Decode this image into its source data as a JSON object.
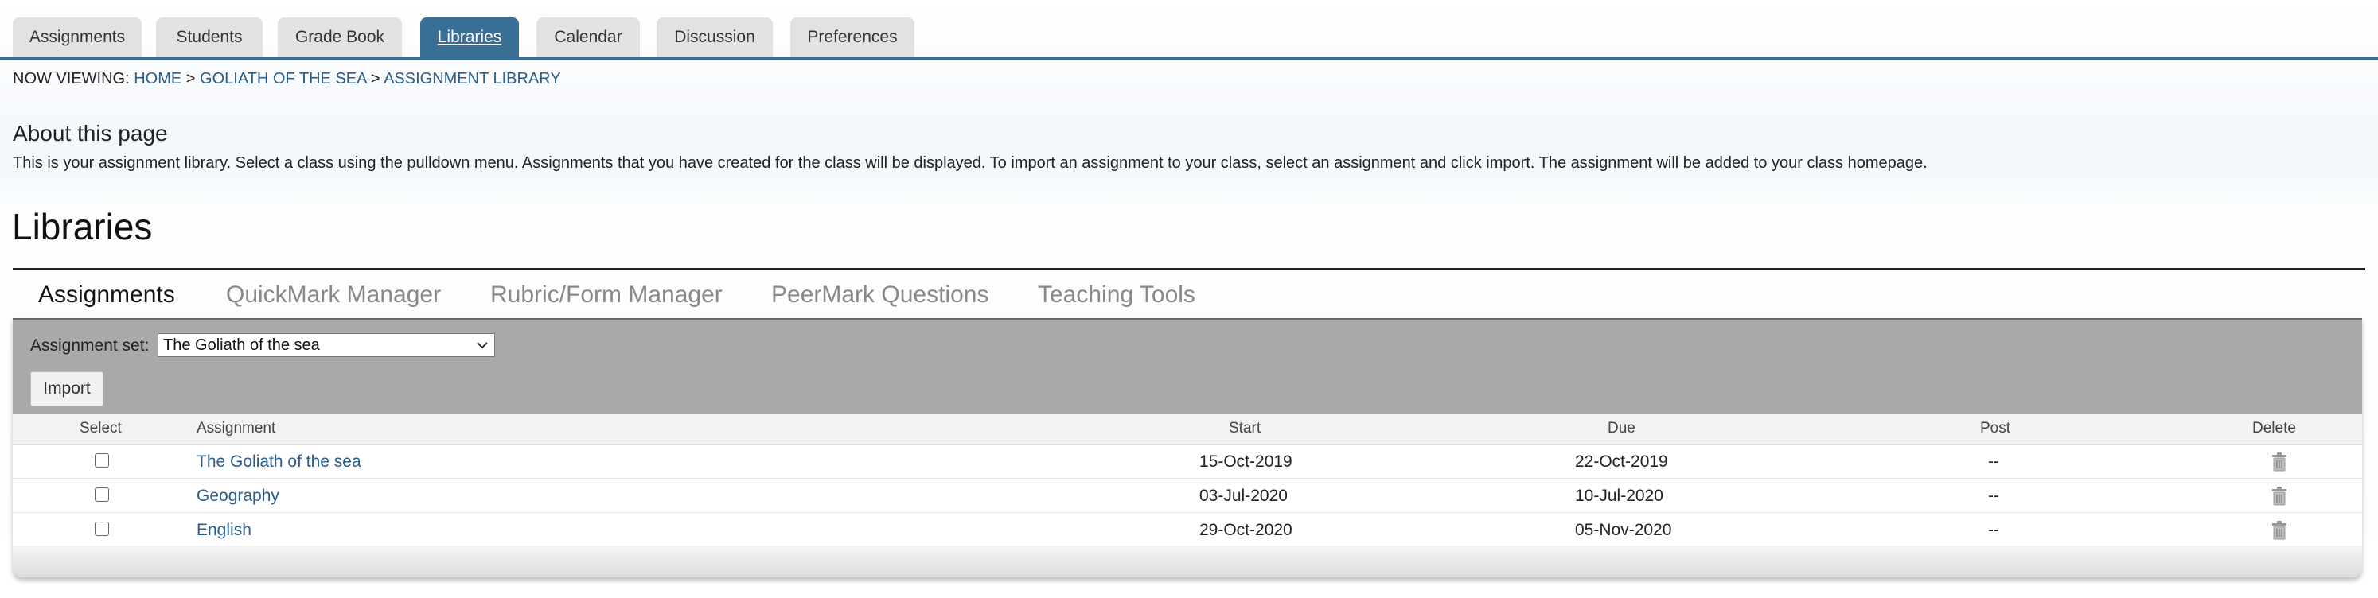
{
  "nav": {
    "tabs": [
      {
        "label": "Assignments"
      },
      {
        "label": "Students"
      },
      {
        "label": "Grade Book"
      },
      {
        "label": "Libraries"
      },
      {
        "label": "Calendar"
      },
      {
        "label": "Discussion"
      },
      {
        "label": "Preferences"
      }
    ],
    "active": "Libraries"
  },
  "breadcrumb": {
    "prefix": "NOW VIEWING:",
    "items": [
      "HOME",
      "GOLIATH OF THE SEA",
      "ASSIGNMENT LIBRARY"
    ],
    "separator": ">"
  },
  "about": {
    "title": "About this page",
    "text": "This is your assignment library. Select a class using the pulldown menu. Assignments that you have created for the class will be displayed. To import an assignment to your class, select an assignment and click import. The assignment will be added to your class homepage."
  },
  "libraries": {
    "title": "Libraries",
    "subtabs": [
      "Assignments",
      "QuickMark Manager",
      "Rubric/Form Manager",
      "PeerMark Questions",
      "Teaching Tools"
    ],
    "active_subtab": "Assignments"
  },
  "controls": {
    "set_label": "Assignment set:",
    "set_value": "The Goliath of the sea",
    "import_label": "Import"
  },
  "table": {
    "headers": {
      "select": "Select",
      "assignment": "Assignment",
      "start": "Start",
      "due": "Due",
      "post": "Post",
      "delete": "Delete"
    },
    "rows": [
      {
        "assignment": "The Goliath of the sea",
        "start": "15-Oct-2019",
        "due": "22-Oct-2019",
        "post": "--"
      },
      {
        "assignment": "Geography",
        "start": "03-Jul-2020",
        "due": "10-Jul-2020",
        "post": "--"
      },
      {
        "assignment": "English",
        "start": "29-Oct-2020",
        "due": "05-Nov-2020",
        "post": "--"
      }
    ]
  },
  "colors": {
    "accent": "#3a6f95",
    "link": "#2b5c8a",
    "control_bar": "#a9a9a9"
  },
  "icons": {
    "delete": "trash-icon",
    "select_chevron": "chevron-down-icon"
  }
}
